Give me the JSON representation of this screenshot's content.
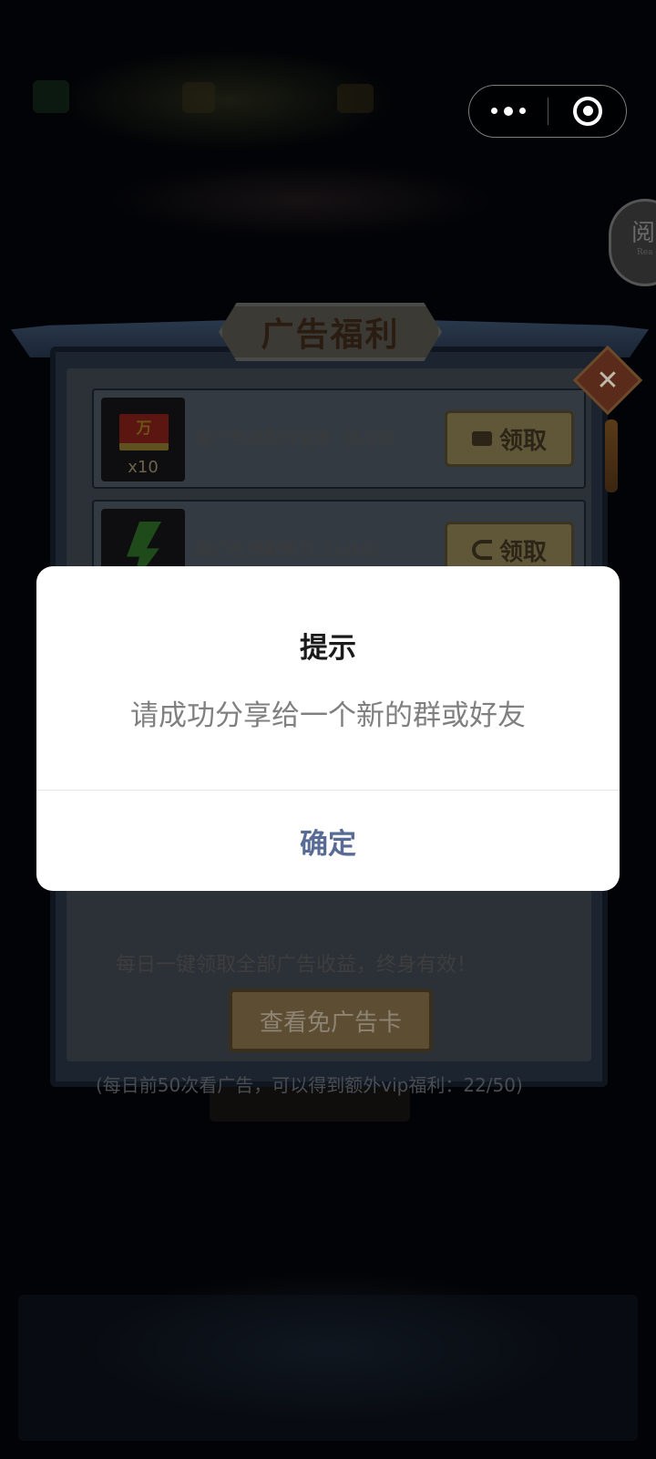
{
  "topbar": {
    "capsule_more_icon": "more-dots-icon",
    "capsule_close_icon": "close-target-icon",
    "read_badge": "阅",
    "read_badge_sub": "Rea"
  },
  "panel": {
    "title": "广告福利",
    "close_glyph": "✕",
    "tasks": [
      {
        "icon": "voucher-icon",
        "icon_text": "万",
        "quantity": "x10",
        "label": "看广告领取万能券（4/20）",
        "button_icon": "video-icon",
        "button_label": "领取"
      },
      {
        "icon": "energy-bolt-icon",
        "label": "看广告领取体力（1/10）",
        "button_icon": "share-icon",
        "button_label": "领取"
      }
    ],
    "vip_promo": "每日一键领取全部广告收益，终身有效！",
    "free_ad_button": "查看免广告卡",
    "vip_note": "(每日前50次看广告，可以得到额外vip福利：22/50)"
  },
  "dialog": {
    "title": "提示",
    "message": "请成功分享给一个新的群或好友",
    "confirm_label": "确定"
  },
  "colors": {
    "dialog_bg": "#ffffff",
    "confirm_text": "#576b95",
    "message_text": "#808080",
    "overlay": "#000000"
  }
}
